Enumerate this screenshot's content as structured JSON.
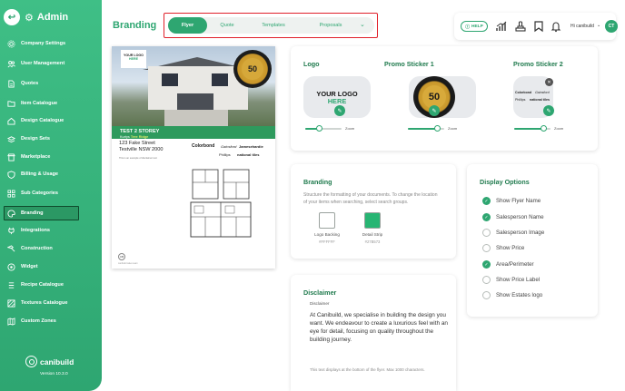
{
  "sidebar": {
    "title": "Admin",
    "items": [
      {
        "label": "Company Settings",
        "icon": "gear-icon"
      },
      {
        "label": "User Management",
        "icon": "users-icon"
      },
      {
        "label": "Quotes",
        "icon": "document-icon"
      },
      {
        "label": "Item Catalogue",
        "icon": "folder-icon"
      },
      {
        "label": "Design Catalogue",
        "icon": "home-icon"
      },
      {
        "label": "Design Sets",
        "icon": "layers-icon"
      },
      {
        "label": "Marketplace",
        "icon": "store-icon"
      },
      {
        "label": "Billing & Usage",
        "icon": "shield-icon"
      },
      {
        "label": "Sub Categories",
        "icon": "grid-icon"
      },
      {
        "label": "Branding",
        "icon": "palette-icon"
      },
      {
        "label": "Integrations",
        "icon": "plug-icon"
      },
      {
        "label": "Construction",
        "icon": "hammer-icon"
      },
      {
        "label": "Widget",
        "icon": "widget-icon"
      },
      {
        "label": "Recipe Catalogue",
        "icon": "list-icon"
      },
      {
        "label": "Textures Catalogue",
        "icon": "texture-icon"
      },
      {
        "label": "Custom Zones",
        "icon": "map-icon"
      }
    ],
    "active_index": 9,
    "brand": "canibuild",
    "version": "Version 10.3.0"
  },
  "header": {
    "title": "Branding",
    "tabs": [
      "Flyer",
      "Quote",
      "Templates",
      "Proposals"
    ],
    "active_tab": 0,
    "help_label": "HELP",
    "greeting": "Hi canibuild",
    "avatar_initials": "CT"
  },
  "flyer_preview": {
    "logo_line1": "YOUR LOGO",
    "logo_line2": "HERE",
    "sticker_number": "50",
    "band_title": "TEST 2 STOREY",
    "band_sub_prefix": "Kurtys",
    "band_sub_accent": "Tree Ridge",
    "address_line1": "123 Fake Street",
    "address_line2": "Testville NSW 2000",
    "small_text": "This is an example of disclaimer text",
    "brands": [
      "Colorbond",
      "Gainsford",
      "Jamesehardie",
      "Phillips",
      "national tiles"
    ],
    "footer_badge": "CB",
    "footer_text": "canibuild sales team"
  },
  "logo_card": {
    "title": "Logo",
    "placeholder_line1": "YOUR LOGO",
    "placeholder_line2": "HERE",
    "zoom_label": "Zoom",
    "zoom_level": 0.38
  },
  "sticker1_card": {
    "title": "Promo Sticker 1",
    "sticker_number": "50",
    "zoom_label": "Zoom",
    "zoom_level": 0.82
  },
  "sticker2_card": {
    "title": "Promo Sticker 2",
    "brands": [
      "Colorbond",
      "Gainsford",
      "Phillips",
      "national tiles"
    ],
    "zoom_label": "Zoom",
    "zoom_level": 0.82
  },
  "branding_card": {
    "title": "Branding",
    "description": "Structure the formatting of your documents. To change the location of your items when searching, select search groups.",
    "swatches": [
      {
        "label": "Logo Backing",
        "code": "#FFFFFF",
        "color": "#ffffff"
      },
      {
        "label": "Detail Strip",
        "code": "#27B573",
        "color": "#27b573"
      }
    ]
  },
  "disclaimer_card": {
    "title": "Disclaimer",
    "field_label": "Disclaimer",
    "text": "At Canibuild, we specialise in building the design you want. We endeavour to create a luxurious feel  with an eye for detail, focusing on quality throughout the building journey.",
    "footer": "This text displays at the bottom of the flyer. Max 1000 characters."
  },
  "display_options": {
    "title": "Display Options",
    "options": [
      {
        "label": "Show Flyer Name",
        "checked": true
      },
      {
        "label": "Salesperson Name",
        "checked": true
      },
      {
        "label": "Salesperson Image",
        "checked": false
      },
      {
        "label": "Show Price",
        "checked": false
      },
      {
        "label": "Area/Perimeter",
        "checked": true
      },
      {
        "label": "Show Price Label",
        "checked": false
      },
      {
        "label": "Show Estates logo",
        "checked": false
      }
    ]
  },
  "colors": {
    "accent": "#2ea671",
    "sidebar": "#3fbf86",
    "highlight_border": "#e0202a"
  }
}
